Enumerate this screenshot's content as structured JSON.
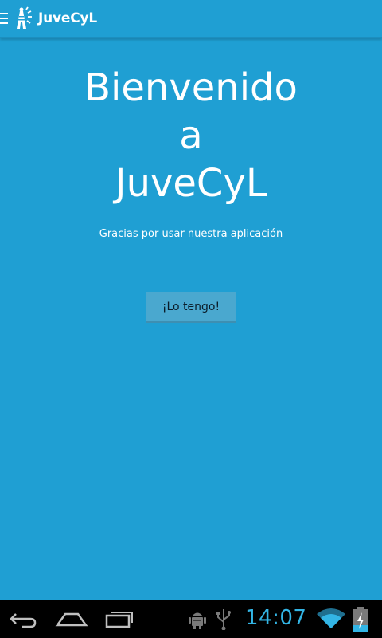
{
  "app": {
    "title": "JuveCyL"
  },
  "welcome": {
    "line1": "Bienvenido",
    "line2": "a",
    "line3": "JuveCyL"
  },
  "subtitle": "Gracias por usar nuestra aplicación",
  "button": {
    "label": "¡Lo tengo!"
  },
  "statusbar": {
    "time": "14:07"
  },
  "icons": {
    "drawer": "drawer-icon",
    "logo": "app-logo-icon",
    "back": "back-icon",
    "home": "home-icon",
    "recents": "recents-icon",
    "android_debug": "android-debug-icon",
    "usb": "usb-icon",
    "wifi": "wifi-icon",
    "battery": "battery-charging-icon"
  },
  "colors": {
    "background": "#1f9fd3",
    "button": "#4aa8cf",
    "clock": "#33b5e5"
  }
}
